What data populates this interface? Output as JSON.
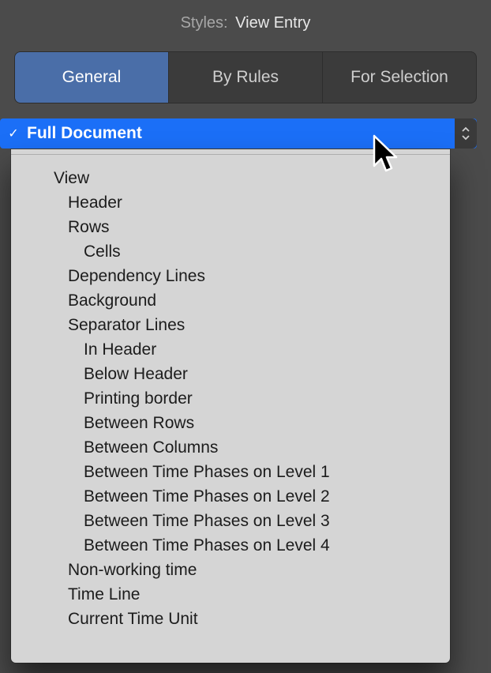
{
  "header": {
    "label": "Styles:",
    "value": "View Entry"
  },
  "tabs": {
    "general": "General",
    "by_rules": "By Rules",
    "for_selection": "For Selection"
  },
  "selector": {
    "checkmark": "✓",
    "label": "Full Document"
  },
  "tree": {
    "items": [
      {
        "label": "View",
        "indent": 0
      },
      {
        "label": "Header",
        "indent": 1
      },
      {
        "label": "Rows",
        "indent": 1
      },
      {
        "label": "Cells",
        "indent": 2
      },
      {
        "label": "Dependency Lines",
        "indent": 1
      },
      {
        "label": "Background",
        "indent": 1
      },
      {
        "label": "Separator Lines",
        "indent": 1
      },
      {
        "label": "In Header",
        "indent": 2
      },
      {
        "label": "Below Header",
        "indent": 2
      },
      {
        "label": "Printing border",
        "indent": 2
      },
      {
        "label": "Between Rows",
        "indent": 2
      },
      {
        "label": "Between Columns",
        "indent": 2
      },
      {
        "label": "Between Time Phases on Level 1",
        "indent": 2
      },
      {
        "label": "Between Time Phases on Level 2",
        "indent": 2
      },
      {
        "label": "Between Time Phases on Level 3",
        "indent": 2
      },
      {
        "label": "Between Time Phases on Level 4",
        "indent": 2
      },
      {
        "label": "Non-working time",
        "indent": 1
      },
      {
        "label": "Time Line",
        "indent": 1
      },
      {
        "label": "Current Time Unit",
        "indent": 1
      }
    ]
  }
}
